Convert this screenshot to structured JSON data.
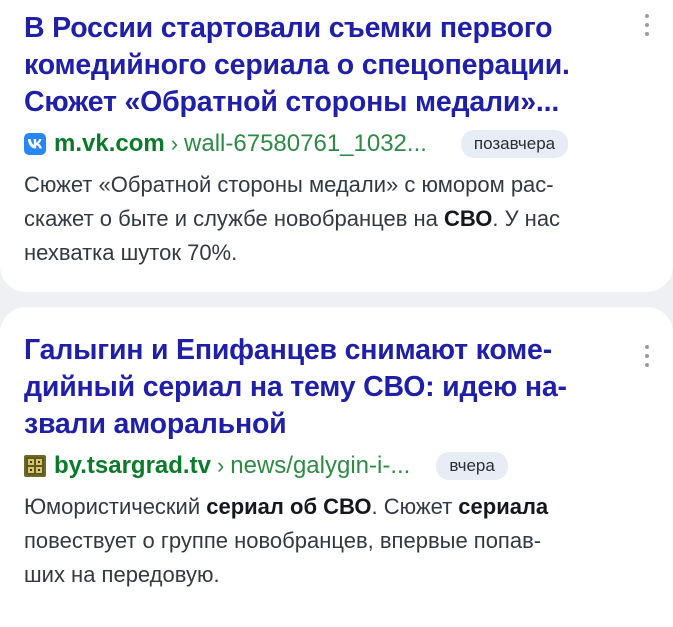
{
  "results": [
    {
      "title_lines": [
        [
          "В России стартовали съемки первого"
        ],
        [
          "комедийного ",
          "сериала",
          " о спецоперации."
        ],
        [
          "Сюжет «Обратной стороны медали»..."
        ]
      ],
      "title_line1": "В России стартовали съемки первого",
      "title_line2_a": "комедийного ",
      "title_line2_b": "сериала",
      "title_line2_c": " о спецоперации.",
      "title_line3": "Сюжет «Обратной стороны медали»...",
      "favicon": "vk-logo-icon",
      "domain": "m.vk.com",
      "separator": "›",
      "path": "wall-67580761_1032...",
      "date": "позавчера",
      "snippet_line1": "Сюжет «Обратной стороны медали» с юмором рас-",
      "snippet_line2_a": "скажет о быте и службе новобранцев на ",
      "snippet_line2_b": "СВО",
      "snippet_line2_c": ". У нас",
      "snippet_line3": "нехватка шуток 70%."
    },
    {
      "title_line1": "Галыгин и Епифанцев снимают коме-",
      "title_line2_a": "дийный ",
      "title_line2_b": "сериал",
      "title_line2_c": " на тему СВО: идею на-",
      "title_line3": "звали аморальной",
      "favicon": "tsargrad-logo-icon",
      "domain": "by.tsargrad.tv",
      "separator": "›",
      "path": "news/galygin-i-...",
      "date": "вчера",
      "snippet_line1_a": "Юмористический ",
      "snippet_line1_b": "сериал об СВО",
      "snippet_line1_c": ". Сюжет ",
      "snippet_line1_d": "сериала",
      "snippet_line2": "повествует о группе новобранцев, впервые попав-",
      "snippet_line3": "ших на передовую."
    }
  ],
  "colors": {
    "title": "#1f1fa8",
    "domain": "#0c7a2b",
    "background": "#eef0f3",
    "card": "#ffffff"
  }
}
